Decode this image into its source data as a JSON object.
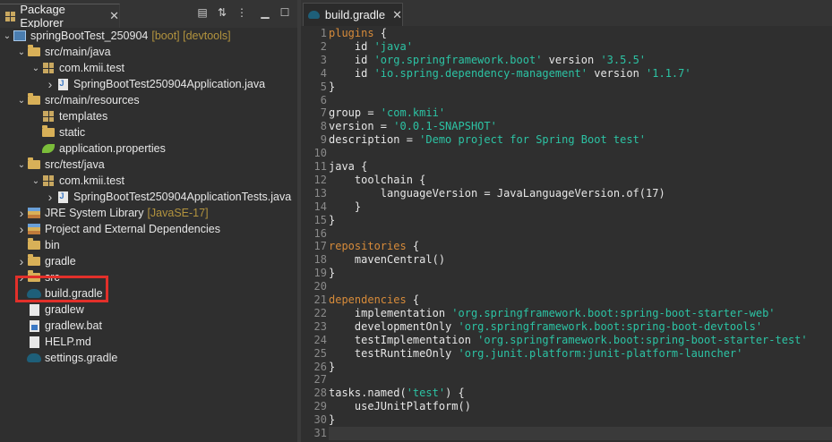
{
  "explorer": {
    "tab_label": "Package Explorer",
    "close_glyph": "✕",
    "toolbar_icons": [
      "collapse-all-icon",
      "link-with-editor-icon",
      "view-menu-icon",
      "minimize-icon",
      "maximize-icon"
    ],
    "items": [
      {
        "label": "springBootTest_250904",
        "suffix": "[boot] [devtools]",
        "depth": 0,
        "expanded": true,
        "icon": "project-icon"
      },
      {
        "label": "src/main/java",
        "suffix": "",
        "depth": 1,
        "expanded": true,
        "icon": "source-folder-icon"
      },
      {
        "label": "com.kmii.test",
        "suffix": "",
        "depth": 2,
        "expanded": true,
        "icon": "package-icon"
      },
      {
        "label": "SpringBootTest250904Application.java",
        "suffix": "",
        "depth": 3,
        "expanded": false,
        "icon": "java-file-icon"
      },
      {
        "label": "src/main/resources",
        "suffix": "",
        "depth": 1,
        "expanded": true,
        "icon": "source-folder-icon"
      },
      {
        "label": "templates",
        "suffix": "",
        "depth": 2,
        "expanded": null,
        "icon": "package-icon"
      },
      {
        "label": "static",
        "suffix": "",
        "depth": 2,
        "expanded": null,
        "icon": "folder-icon"
      },
      {
        "label": "application.properties",
        "suffix": "",
        "depth": 2,
        "expanded": null,
        "icon": "properties-icon"
      },
      {
        "label": "src/test/java",
        "suffix": "",
        "depth": 1,
        "expanded": true,
        "icon": "source-folder-icon"
      },
      {
        "label": "com.kmii.test",
        "suffix": "",
        "depth": 2,
        "expanded": true,
        "icon": "package-icon"
      },
      {
        "label": "SpringBootTest250904ApplicationTests.java",
        "suffix": "",
        "depth": 3,
        "expanded": false,
        "icon": "java-file-icon"
      },
      {
        "label": "JRE System Library",
        "suffix": "[JavaSE-17]",
        "depth": 1,
        "expanded": false,
        "icon": "library-icon"
      },
      {
        "label": "Project and External Dependencies",
        "suffix": "",
        "depth": 1,
        "expanded": false,
        "icon": "library-icon"
      },
      {
        "label": "bin",
        "suffix": "",
        "depth": 1,
        "expanded": null,
        "icon": "folder-icon"
      },
      {
        "label": "gradle",
        "suffix": "",
        "depth": 1,
        "expanded": false,
        "icon": "folder-icon"
      },
      {
        "label": "src",
        "suffix": "",
        "depth": 1,
        "expanded": false,
        "icon": "folder-icon"
      },
      {
        "label": "build.gradle",
        "suffix": "",
        "depth": 1,
        "expanded": null,
        "icon": "gradle-icon"
      },
      {
        "label": "gradlew",
        "suffix": "",
        "depth": 1,
        "expanded": null,
        "icon": "text-file-icon"
      },
      {
        "label": "gradlew.bat",
        "suffix": "",
        "depth": 1,
        "expanded": null,
        "icon": "bat-file-icon"
      },
      {
        "label": "HELP.md",
        "suffix": "",
        "depth": 1,
        "expanded": null,
        "icon": "markdown-file-icon"
      },
      {
        "label": "settings.gradle",
        "suffix": "",
        "depth": 1,
        "expanded": null,
        "icon": "gradle-icon"
      }
    ]
  },
  "editor": {
    "tab_label": "build.gradle",
    "close_glyph": "✕",
    "lines": [
      [
        [
          "kw",
          "plugins"
        ],
        [
          "plain",
          " {"
        ]
      ],
      [
        [
          "plain",
          "    id "
        ],
        [
          "str",
          "'java'"
        ]
      ],
      [
        [
          "plain",
          "    id "
        ],
        [
          "str",
          "'org.springframework.boot'"
        ],
        [
          "plain",
          " version "
        ],
        [
          "str",
          "'3.5.5'"
        ]
      ],
      [
        [
          "plain",
          "    id "
        ],
        [
          "str",
          "'io.spring.dependency-management'"
        ],
        [
          "plain",
          " version "
        ],
        [
          "str",
          "'1.1.7'"
        ]
      ],
      [
        [
          "plain",
          "}"
        ]
      ],
      [],
      [
        [
          "plain",
          "group = "
        ],
        [
          "str",
          "'com.kmii'"
        ]
      ],
      [
        [
          "plain",
          "version = "
        ],
        [
          "str",
          "'0.0.1-SNAPSHOT'"
        ]
      ],
      [
        [
          "plain",
          "description = "
        ],
        [
          "str",
          "'Demo project for Spring Boot test'"
        ]
      ],
      [],
      [
        [
          "plain",
          "java {"
        ]
      ],
      [
        [
          "plain",
          "    toolchain {"
        ]
      ],
      [
        [
          "plain",
          "        languageVersion = JavaLanguageVersion.of(17)"
        ]
      ],
      [
        [
          "plain",
          "    }"
        ]
      ],
      [
        [
          "plain",
          "}"
        ]
      ],
      [],
      [
        [
          "kw",
          "repositories"
        ],
        [
          "plain",
          " {"
        ]
      ],
      [
        [
          "plain",
          "    mavenCentral()"
        ]
      ],
      [
        [
          "plain",
          "}"
        ]
      ],
      [],
      [
        [
          "kw",
          "dependencies"
        ],
        [
          "plain",
          " {"
        ]
      ],
      [
        [
          "plain",
          "    implementation "
        ],
        [
          "str",
          "'org.springframework.boot:spring-boot-starter-web'"
        ]
      ],
      [
        [
          "plain",
          "    developmentOnly "
        ],
        [
          "str",
          "'org.springframework.boot:spring-boot-devtools'"
        ]
      ],
      [
        [
          "plain",
          "    testImplementation "
        ],
        [
          "str",
          "'org.springframework.boot:spring-boot-starter-test'"
        ]
      ],
      [
        [
          "plain",
          "    testRuntimeOnly "
        ],
        [
          "str",
          "'org.junit.platform:junit-platform-launcher'"
        ]
      ],
      [
        [
          "plain",
          "}"
        ]
      ],
      [],
      [
        [
          "plain",
          "tasks.named("
        ],
        [
          "str",
          "'test'"
        ],
        [
          "plain",
          ") {"
        ]
      ],
      [
        [
          "plain",
          "    useJUnitPlatform()"
        ]
      ],
      [
        [
          "plain",
          "}"
        ]
      ],
      []
    ]
  },
  "colors": {
    "keyword": "#d78b3a",
    "string": "#2cc3a4",
    "highlight_box": "#e2302a"
  }
}
